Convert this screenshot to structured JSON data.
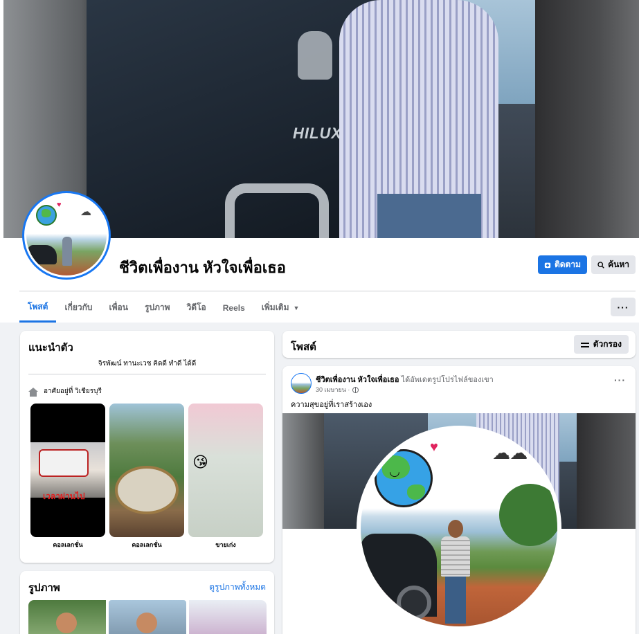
{
  "page": {
    "name": "ชีวิตเพื่องาน หัวใจเพื่อเธอ",
    "cover_badge": "HILUX",
    "follow_label": "ติดตาม",
    "search_label": "ค้นหา",
    "more_label": "···"
  },
  "tabs": [
    {
      "label": "โพสต์",
      "active": true
    },
    {
      "label": "เกี่ยวกับ"
    },
    {
      "label": "เพื่อน"
    },
    {
      "label": "รูปภาพ"
    },
    {
      "label": "วิดีโอ"
    },
    {
      "label": "Reels"
    },
    {
      "label": "เพิ่มเติม"
    }
  ],
  "intro": {
    "title": "แนะนำตัว",
    "bio": "จิรพัฒน์ ทานะเวช คิดดี ทำดี ได้ดี",
    "lives_in": "อาศัยอยู่ที่ วิเชียรบุรี",
    "collections": [
      {
        "label": "คอลเลกชั่น",
        "overlay": "เวลาผ่านไป"
      },
      {
        "label": "คอลเลกชั่น"
      },
      {
        "label": "ขายเก่ง"
      }
    ]
  },
  "photos": {
    "title": "รูปภาพ",
    "see_all": "ดูรูปภาพทั้งหมด"
  },
  "posts": {
    "title": "โพสต์",
    "filter_label": "ตัวกรอง"
  },
  "post": {
    "author": "ชีวิตเพื่องาน หัวใจเพื่อเธอ",
    "action": "ได้อัพเดตรูปโปรไฟล์ของเขา",
    "date": "30 เมษายน ·",
    "text": "ความสุขอยู่ที่เราสร้างเอง",
    "menu": "···"
  },
  "colors": {
    "accent": "#1b74e4",
    "background": "#f0f2f5",
    "card": "#ffffff"
  },
  "icons": [
    "follow-icon",
    "search-icon",
    "caret-down-icon",
    "house-icon",
    "filter-icon",
    "globe-icon",
    "more-icon"
  ]
}
